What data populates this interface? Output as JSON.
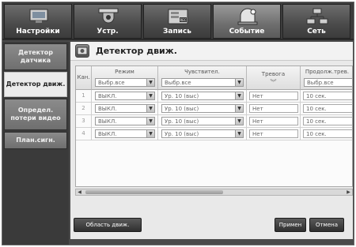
{
  "top_tabs": [
    {
      "label": "Настройки",
      "icon": "monitor-icon",
      "active": false
    },
    {
      "label": "Устр.",
      "icon": "camera-icon",
      "active": false
    },
    {
      "label": "Запись",
      "icon": "record-icon",
      "active": false
    },
    {
      "label": "Событие",
      "icon": "event-icon",
      "active": true
    },
    {
      "label": "Сеть",
      "icon": "network-icon",
      "active": false
    }
  ],
  "left_menu": [
    {
      "label": "Детектор датчика",
      "active": false
    },
    {
      "label": "Детектор движ.",
      "active": true
    },
    {
      "label": "Определ. потери видео",
      "active": false
    },
    {
      "label": "План.сигн.",
      "active": false
    }
  ],
  "page": {
    "title": "Детектор движ.",
    "icon": "motion-detector-icon"
  },
  "table": {
    "columns": {
      "channel": "Кан.",
      "mode": "Режим",
      "sensitivity": "Чувствител.",
      "alarm": "Тревога",
      "duration": "Продолж.трев."
    },
    "header_selects": {
      "mode": "Выбр.все",
      "sensitivity": "Выбр.все",
      "duration": "Выбр.все"
    },
    "rows": [
      {
        "ch": "1",
        "mode": "ВЫКЛ.",
        "sensitivity": "Ур. 10 (выс)",
        "alarm": "Нет",
        "duration": "10 сек."
      },
      {
        "ch": "2",
        "mode": "ВЫКЛ.",
        "sensitivity": "Ур. 10 (выс)",
        "alarm": "Нет",
        "duration": "10 сек."
      },
      {
        "ch": "3",
        "mode": "ВЫКЛ.",
        "sensitivity": "Ур. 10 (выс)",
        "alarm": "Нет",
        "duration": "10 сек."
      },
      {
        "ch": "4",
        "mode": "ВЫКЛ.",
        "sensitivity": "Ур. 10 (выс)",
        "alarm": "Нет",
        "duration": "10 сек."
      }
    ]
  },
  "buttons": {
    "motion_area": "Область движ.",
    "apply": "Примен",
    "cancel": "Отмена"
  },
  "colors": {
    "accent_dark": "#3a3a3a",
    "active_tab": "#7a7a7a",
    "panel": "#e9e9e9"
  }
}
